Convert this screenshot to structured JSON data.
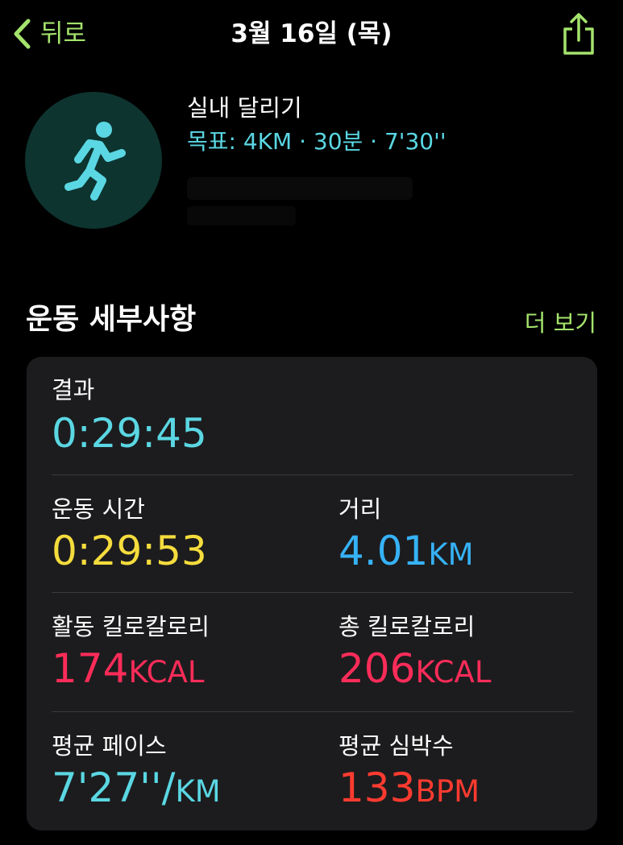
{
  "nav": {
    "back_label": "뒤로",
    "title": "3월 16일 (목)"
  },
  "workout": {
    "title": "실내 달리기",
    "goal": "목표: 4KM · 30분 · 7'30''"
  },
  "section": {
    "title": "운동 세부사항",
    "more_label": "더 보기"
  },
  "metrics": {
    "result": {
      "label": "결과",
      "value": "0:29:45",
      "unit": "",
      "color": "#5ad7e3"
    },
    "duration": {
      "label": "운동 시간",
      "value": "0:29:53",
      "unit": "",
      "color": "#f5dc3d"
    },
    "distance": {
      "label": "거리",
      "value": "4.01",
      "unit": "KM",
      "color": "#36b2f7"
    },
    "active_cal": {
      "label": "활동 킬로칼로리",
      "value": "174",
      "unit": "KCAL",
      "color": "#fb2c59"
    },
    "total_cal": {
      "label": "총 킬로칼로리",
      "value": "206",
      "unit": "KCAL",
      "color": "#fb2c59"
    },
    "pace": {
      "label": "평균 페이스",
      "value": "7'27''/",
      "unit": "KM",
      "color": "#5ad7e3"
    },
    "heart_rate": {
      "label": "평균 심박수",
      "value": "133",
      "unit": "BPM",
      "color": "#ff3b30"
    }
  },
  "colors": {
    "accent_green": "#a4e36c",
    "icon_bg": "#0e3430",
    "icon_fg": "#5ad7e3"
  },
  "icons": [
    "chevron-left-icon",
    "share-icon",
    "running-figure-icon"
  ]
}
